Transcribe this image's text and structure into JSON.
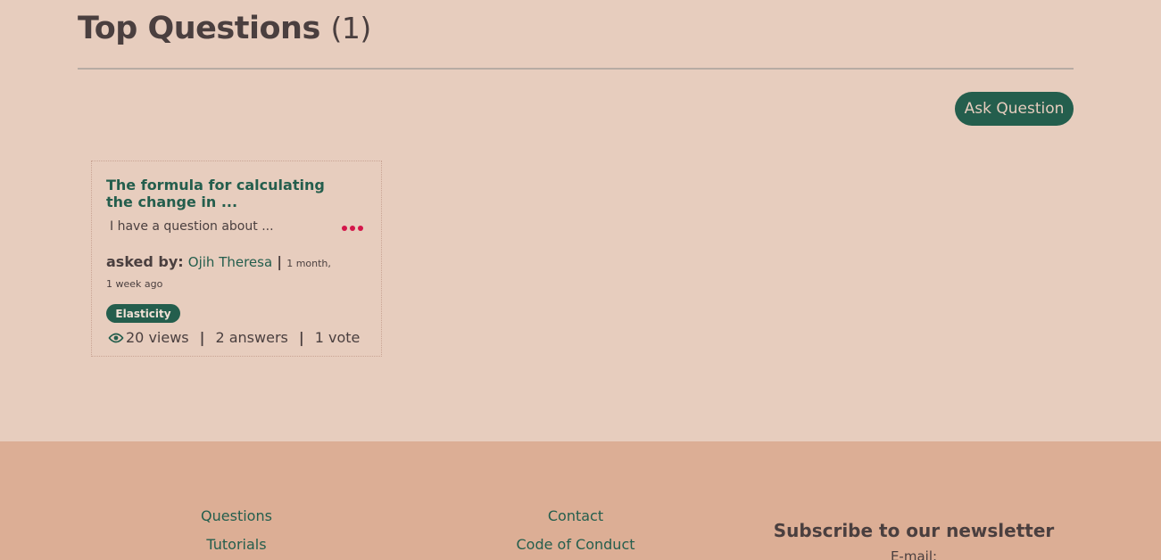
{
  "header": {
    "title": "Top Questions",
    "count": "(1)"
  },
  "actions": {
    "ask_label": "Ask Question"
  },
  "question": {
    "title": "The formula for calculating the change in ...",
    "excerpt": "I have a question about ...",
    "asked_by_label": "asked by:",
    "author": "Ojih Theresa",
    "separator": "|",
    "time_line1": "1 month,",
    "time_line2": "1 week ago",
    "tag": "Elasticity",
    "views": "20 views",
    "answers": "2 answers",
    "votes": "1 vote",
    "stat_sep": "|"
  },
  "footer": {
    "links_col1": [
      "Questions",
      "Tutorials"
    ],
    "links_col2": [
      "Contact",
      "Code of Conduct"
    ],
    "newsletter_title": "Subscribe to our newsletter",
    "email_label": "E-mail:"
  },
  "colors": {
    "accent": "#245e4d",
    "background": "#e7cdbe",
    "footer": "#dcae95",
    "dots": "#d4164a"
  },
  "icons": {
    "views": "eye-icon",
    "menu": "more-dots-icon"
  }
}
